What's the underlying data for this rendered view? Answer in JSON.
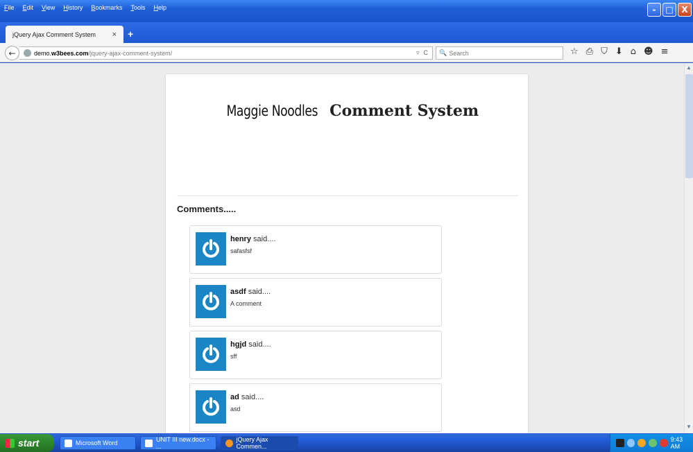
{
  "browser": {
    "menu": [
      "File",
      "Edit",
      "View",
      "History",
      "Bookmarks",
      "Tools",
      "Help"
    ],
    "window_controls": {
      "minimize": "-",
      "maximize": "□",
      "close": "X"
    },
    "tab": {
      "title": "jQuery Ajax Comment System",
      "close": "×"
    },
    "new_tab": "+",
    "url": {
      "host_prefix": "demo.",
      "host_bold": "w3bees.com",
      "path": "/jquery-ajax-comment-system/"
    },
    "url_tools": {
      "dropdown": "▿",
      "reload": "C"
    },
    "search": {
      "icon": "🔍",
      "placeholder": "Search"
    },
    "toolbar_icons": [
      "☆",
      "⎙",
      "⛉",
      "⬇",
      "⌂",
      "☻",
      "≡"
    ]
  },
  "page": {
    "title_light": "Maggie Noodles",
    "title_bold": "Comment System",
    "comments_heading": "Comments.....",
    "said_suffix": "said....",
    "comments": [
      {
        "author": "henry",
        "text": "safasfsf"
      },
      {
        "author": "asdf",
        "text": "A comment"
      },
      {
        "author": "hgjd",
        "text": "sff"
      },
      {
        "author": "ad",
        "text": "asd"
      }
    ]
  },
  "taskbar": {
    "start_label": "start",
    "items": [
      {
        "label": "Microsoft Word"
      },
      {
        "label": "UNIT III new.docx - ..."
      },
      {
        "label": "jQuery Ajax Commen..."
      }
    ],
    "clock": "9:43 AM"
  },
  "colors": {
    "accent": "#1a86c6",
    "taskbar": "#245edb",
    "start": "#2f8a2e"
  }
}
